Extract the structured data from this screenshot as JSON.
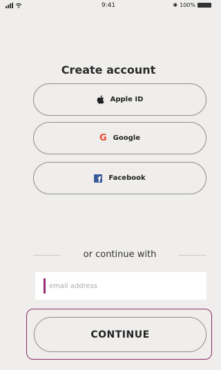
{
  "status_bar": {
    "time": "9:41",
    "battery_text": "100%",
    "bluetooth_glyph": "✱"
  },
  "title": "Create account",
  "providers": [
    {
      "label": "Apple ID",
      "icon": "apple-icon"
    },
    {
      "label": "Google",
      "icon": "google-icon",
      "icon_glyph": "G",
      "icon_color": "#e8452f"
    },
    {
      "label": "Facebook",
      "icon": "facebook-icon",
      "icon_glyph": "f",
      "icon_color": "#3b5998"
    }
  ],
  "divider": {
    "text": "or continue with"
  },
  "email": {
    "placeholder": "email address",
    "value": ""
  },
  "continue": {
    "label": "CONTINUE",
    "accent": "#8b2a6a"
  }
}
